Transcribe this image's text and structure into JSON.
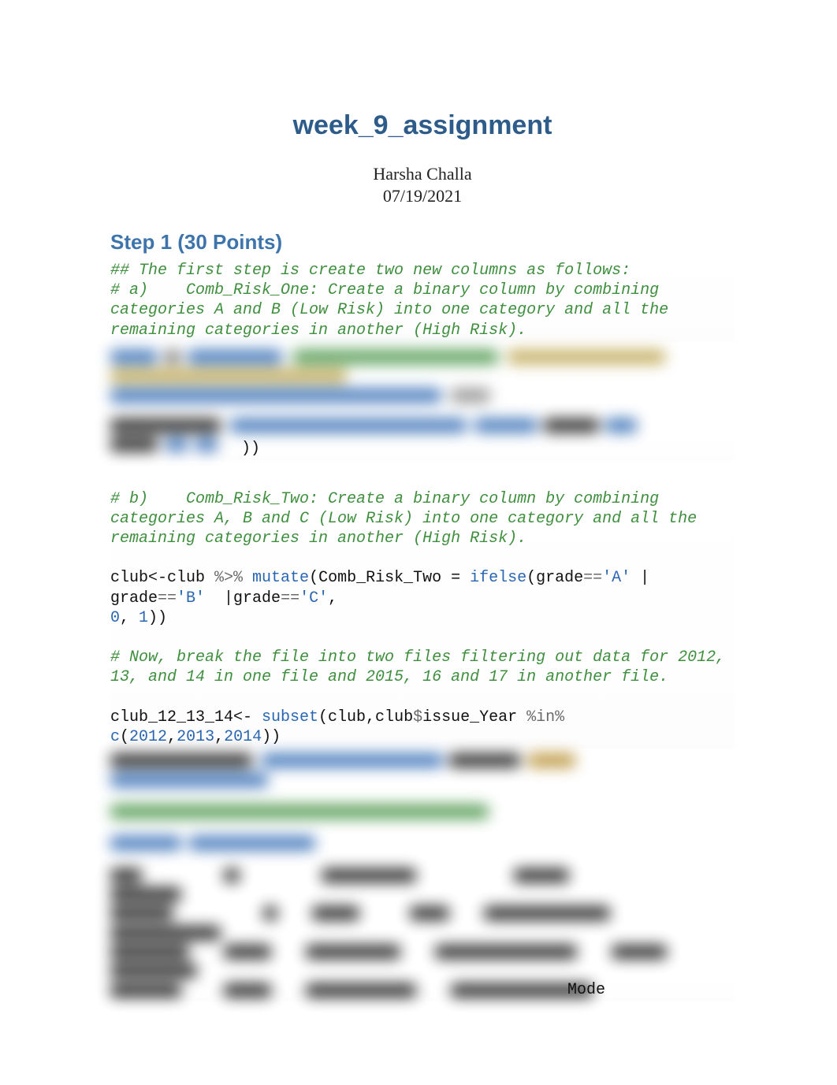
{
  "title": "week_9_assignment",
  "author": "Harsha Challa",
  "date": "07/19/2021",
  "step_heading": "Step 1 (30 Points)",
  "code": {
    "comment_a1": "## The first step is create two new columns as follows:",
    "comment_a2": "# a)    Comb_Risk_One: Create a binary column by combining categories A and B (Low Risk) into one category and all the remaining categories in another (High Risk).",
    "visible_after_blur1": "))",
    "comment_b": "# b)    Comb_Risk_Two: Create a binary column by combining categories A, B and C (Low Risk) into one category and all the remaining categories in another (High Risk).",
    "line_b1_pre": "club<-club ",
    "line_b1_pipe": "%>%",
    "line_b1_mutate": " mutate",
    "line_b1_open": "(Comb_Risk_Two = ",
    "line_b1_ifelse": "ifelse",
    "line_b1_cond1a": "(grade",
    "line_b1_eq": "==",
    "line_b1_strA": "'A'",
    "line_b1_or": " | ",
    "line_b2_pre": "grade",
    "line_b2_strB": "'B'",
    "line_b2_mid": "  |grade",
    "line_b2_strC": "'C'",
    "line_b2_end": ",",
    "line_b3_zero": "0",
    "line_b3_mid": ", ",
    "line_b3_one": "1",
    "line_b3_end": "))",
    "comment_c": "# Now, break the file into two files filtering out data for 2012, 13, and 14 in one file and 2015, 16 and 17 in another file.",
    "line_c1_pre": "club_12_13_14<- ",
    "line_c1_subset": "subset",
    "line_c1_args1": "(club,club",
    "line_c1_dollar": "$",
    "line_c1_args2": "issue_Year ",
    "line_c1_in": "%in%",
    "line_c2_c": "c",
    "line_c2_open": "(",
    "line_c2_y1": "2012",
    "line_c2_comma": ",",
    "line_c2_y2": "2013",
    "line_c2_y3": "2014",
    "line_c2_close": "))",
    "tail_visible": "Mode"
  }
}
